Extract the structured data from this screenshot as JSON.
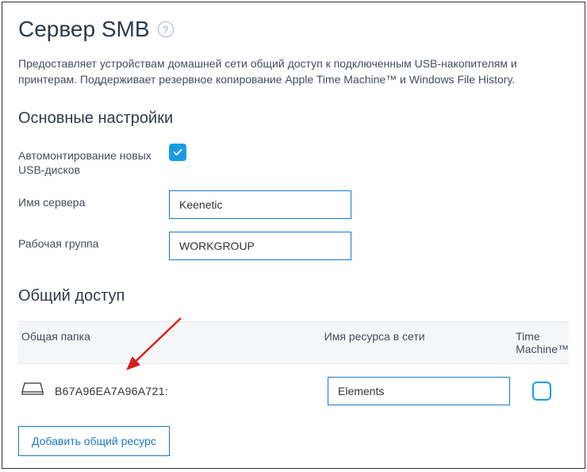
{
  "header": {
    "title": "Сервер SMB",
    "helpGlyph": "?"
  },
  "description": "Предоставляет устройствам домашней сети общий доступ к подключенным USB-накопителям и принтерам. Поддерживает резервное копирование Apple Time Machine™ и Windows File History.",
  "basic": {
    "sectionTitle": "Основные настройки",
    "automountLabel": "Автомонтирование новых USB-дисков",
    "automountChecked": true,
    "serverNameLabel": "Имя сервера",
    "serverNameValue": "Keenetic",
    "workgroupLabel": "Рабочая группа",
    "workgroupValue": "WORKGROUP"
  },
  "sharing": {
    "sectionTitle": "Общий доступ",
    "columns": {
      "folder": "Общая папка",
      "resource": "Имя ресурса в сети",
      "timeMachine": "Time Machine™"
    },
    "rows": [
      {
        "folderName": "B67A96EA7A96A721:",
        "resourceName": "Elements",
        "timeMachineChecked": false
      }
    ],
    "addButton": "Добавить общий ресурс"
  }
}
